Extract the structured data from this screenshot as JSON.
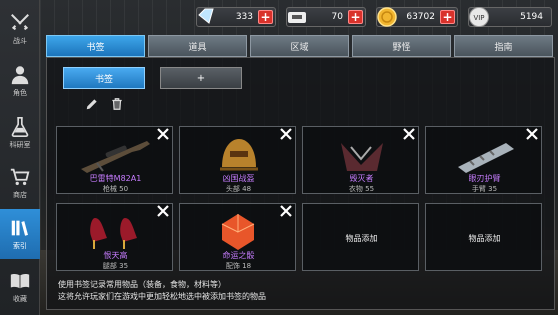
{
  "sidebar": {
    "items": [
      {
        "label": "战斗",
        "icon": "crossed-swords-icon"
      },
      {
        "label": "角色",
        "icon": "character-icon"
      },
      {
        "label": "科研室",
        "icon": "flask-icon"
      },
      {
        "label": "商店",
        "icon": "shop-cart-icon"
      },
      {
        "label": "索引",
        "icon": "index-books-icon",
        "active": true
      },
      {
        "label": "收藏",
        "icon": "open-book-icon"
      }
    ]
  },
  "currency": {
    "crystal": "333",
    "ammo": "70",
    "gold": "63702",
    "vip": "5194"
  },
  "tabs": [
    {
      "label": "书签",
      "active": true
    },
    {
      "label": "道具"
    },
    {
      "label": "区域"
    },
    {
      "label": "野怪"
    },
    {
      "label": "指南"
    }
  ],
  "bookmark": {
    "tab_button": "书签",
    "add_button": "+"
  },
  "slots": [
    {
      "name": "巴雷特M82A1",
      "sub": "枪械 50",
      "art": "sniper-rifle"
    },
    {
      "name": "凶国战盔",
      "sub": "头部 48",
      "art": "helmet"
    },
    {
      "name": "毁灭者",
      "sub": "衣物 55",
      "art": "armor"
    },
    {
      "name": "眼刃护臂",
      "sub": "手臂 35",
      "art": "arm-guard"
    },
    {
      "name": "恨天高",
      "sub": "腿部 35",
      "art": "high-heels"
    },
    {
      "name": "命运之骰",
      "sub": "配饰 18",
      "art": "dice"
    },
    {
      "empty": true,
      "label": "物品添加"
    },
    {
      "empty": true,
      "label": "物品添加"
    }
  ],
  "hints": [
    "使用书签记录常用物品（装备，食物，材料等）",
    "这将允许玩家们在游戏中更加轻松地选中被添加书签的物品"
  ],
  "colors": {
    "accent": "#2f8fd8",
    "rare": "#c77dff",
    "plus": "#d9322b"
  }
}
